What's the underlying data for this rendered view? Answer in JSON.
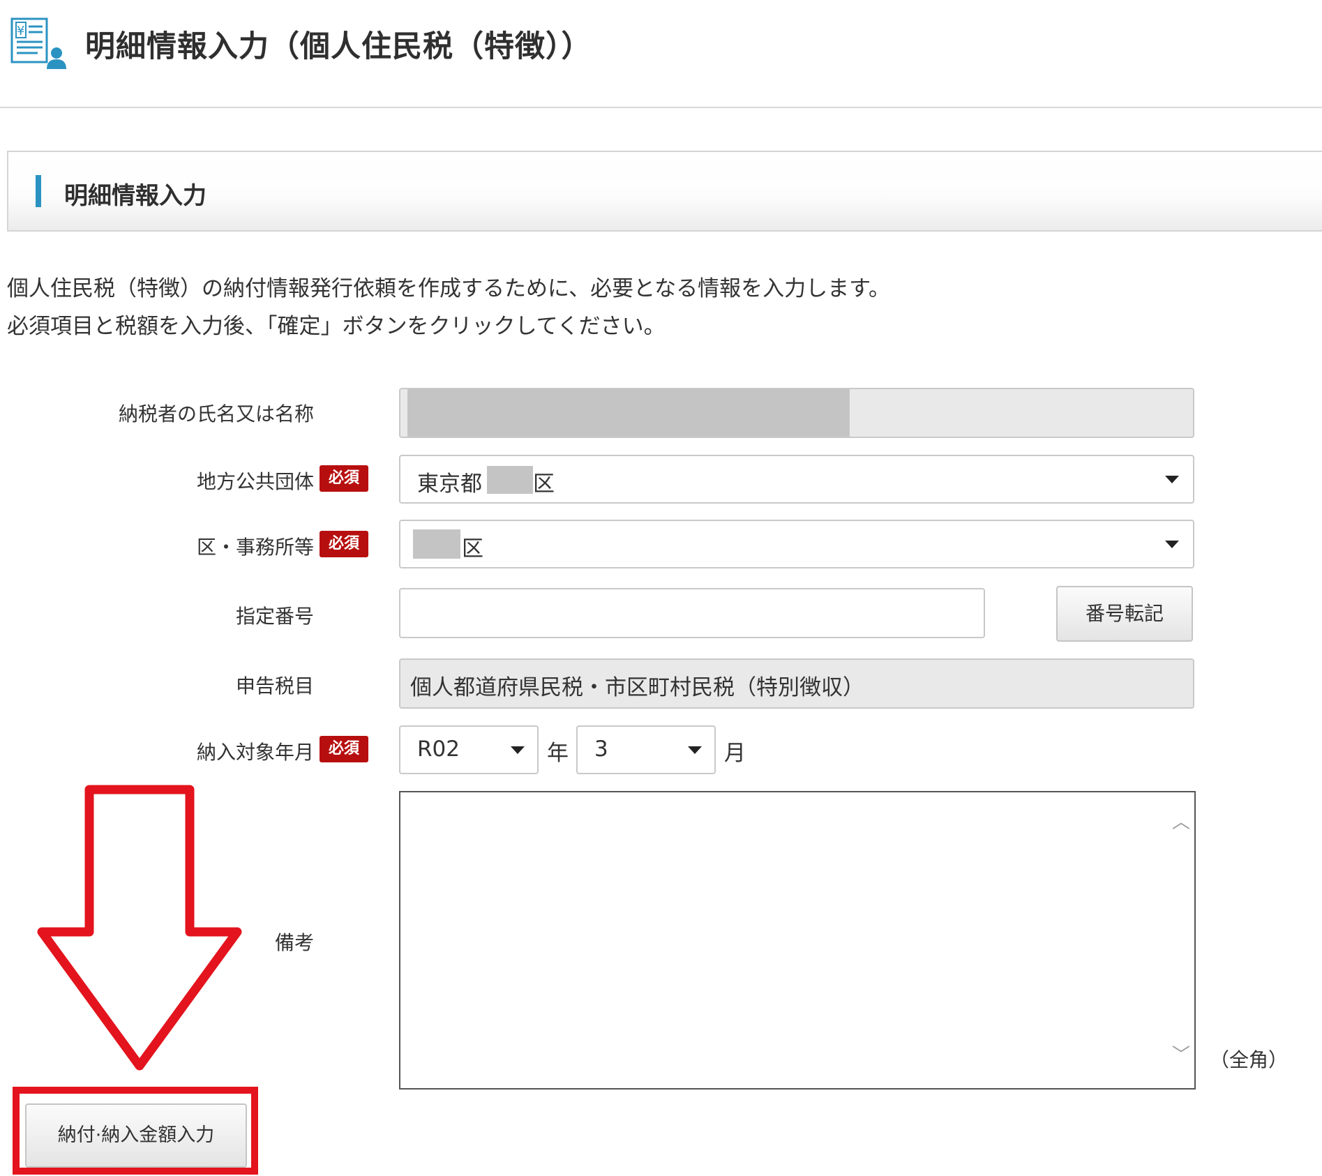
{
  "header": {
    "title": "明細情報入力（個人住民税（特徴））",
    "icon": "tax-document-user-icon"
  },
  "section": {
    "title": "明細情報入力"
  },
  "intro": {
    "line1": "個人住民税（特徴）の納付情報発行依頼を作成するために、必要となる情報を入力します。",
    "line2": "必須項目と税額を入力後、「確定」ボタンをクリックしてください。"
  },
  "form": {
    "required_badge": "必須",
    "taxpayer_name": {
      "label": "納税者の氏名又は名称",
      "value": ""
    },
    "local_government": {
      "label": "地方公共団体",
      "value_prefix": "東京都",
      "value_suffix": "区"
    },
    "ward_office": {
      "label": "区・事務所等",
      "value_suffix": "区"
    },
    "designated_number": {
      "label": "指定番号",
      "value": "",
      "transfer_button": "番号転記"
    },
    "tax_item": {
      "label": "申告税目",
      "value": "個人都道府県民税・市区町村民税（特別徴収）"
    },
    "payment_period": {
      "label": "納入対象年月",
      "year_value": "R02",
      "year_unit": "年",
      "month_value": "3",
      "month_unit": "月"
    },
    "remarks": {
      "label": "備考",
      "value": "",
      "note": "（全角）"
    }
  },
  "actions": {
    "amount_input_button": "納付·納入金額入力"
  },
  "colors": {
    "required_badge": "#b70f0f",
    "accent": "#2b93c2",
    "annotation": "#e3141d"
  }
}
